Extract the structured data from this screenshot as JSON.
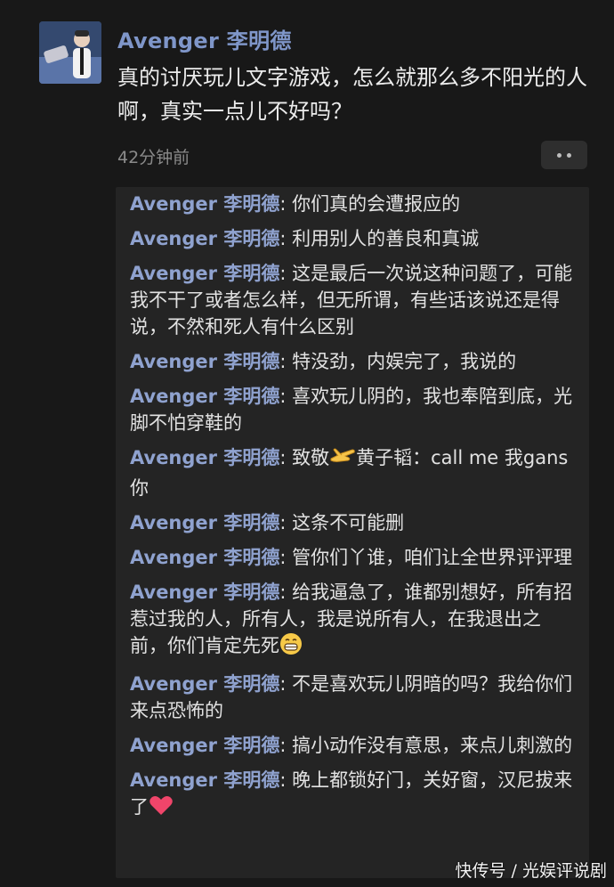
{
  "post": {
    "author": "Avenger 李明德",
    "text": "真的讨厌玩儿文字游戏，怎么就那么多不阳光的人啊，真实一点儿不好吗？",
    "timestamp": "42分钟前"
  },
  "comments": [
    {
      "author": "Avenger 李明德",
      "text": "你们真的会遭报应的"
    },
    {
      "author": "Avenger 李明德",
      "text": "利用别人的善良和真诚"
    },
    {
      "author": "Avenger 李明德",
      "text": "这是最后一次说这种问题了，可能我不干了或者怎么样，但无所谓，有些话该说还是得说，不然和死人有什么区别"
    },
    {
      "author": "Avenger 李明德",
      "text": "特没劲，内娱完了，我说的"
    },
    {
      "author": "Avenger 李明德",
      "text": "喜欢玩儿阴的，我也奉陪到底，光脚不怕穿鞋的"
    },
    {
      "author": "Avenger 李明德",
      "text_before": "致敬",
      "emoji": "salute-hand-emoji",
      "text": "黄子韬：call me 我gans你"
    },
    {
      "author": "Avenger 李明德",
      "text": "这条不可能删"
    },
    {
      "author": "Avenger 李明德",
      "text": "管你们丫谁，咱们让全世界评评理"
    },
    {
      "author": "Avenger 李明德",
      "text": "给我逼急了，谁都别想好，所有招惹过我的人，所有人，我是说所有人，在我退出之前，你们肯定先死",
      "emoji_after": "grin-emoji"
    },
    {
      "author": "Avenger 李明德",
      "text": "不是喜欢玩儿阴暗的吗？我给你们来点恐怖的"
    },
    {
      "author": "Avenger 李明德",
      "text": "搞小动作没有意思，来点儿刺激的"
    },
    {
      "author": "Avenger 李明德",
      "text": "晚上都锁好门，关好窗，汉尼拔来了",
      "emoji_after": "heart-emoji"
    }
  ],
  "separator": ": ",
  "watermark": "快传号 / 光娱评说剧",
  "colors": {
    "background": "#181818",
    "comment_panel": "#242424",
    "author_blue": "#7f96c9"
  }
}
